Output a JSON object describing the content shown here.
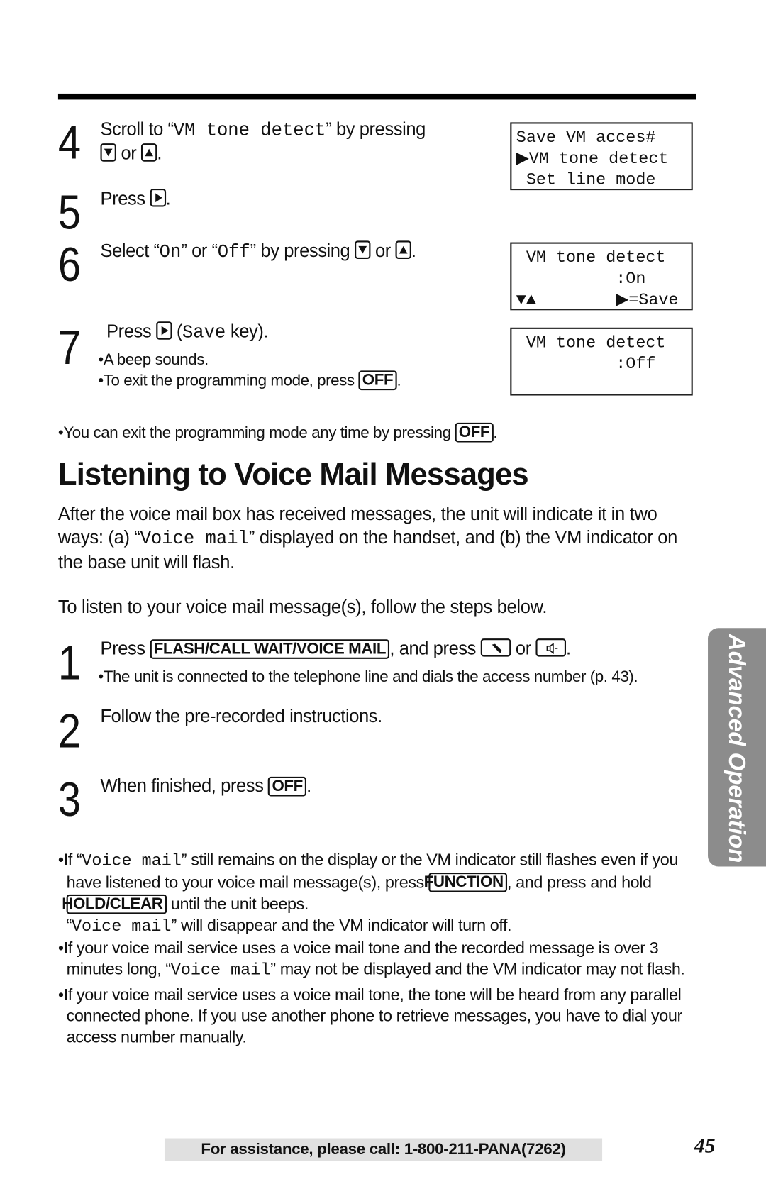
{
  "steps_top": [
    {
      "num": "4",
      "pre": "Scroll to “",
      "mono": "VM tone detect",
      "post": "” by pressing",
      "line2_or": " or ",
      "line2_end": "."
    },
    {
      "num": "5",
      "pre": "Press ",
      "end": "."
    },
    {
      "num": "6",
      "a": "Select “",
      "on": "On",
      "b": "” or “",
      "off": "Off",
      "c": "” by pressing ",
      "or": " or ",
      "end": "."
    },
    {
      "num": "7",
      "pre": "Press ",
      "paren_open": " (",
      "save": "Save",
      "post": " key).",
      "bullet1": "•A beep sounds.",
      "bullet2": "•To exit the programming mode, press ",
      "off_key": "OFF",
      "end": "."
    }
  ],
  "lcd": [
    [
      "Save VM acces#",
      "▶VM tone detect",
      " Set line mode"
    ],
    [
      " VM tone detect",
      "          :On",
      "▼▲        ▶=Save"
    ],
    [
      " VM tone detect",
      "          :Off",
      ""
    ]
  ],
  "exit_note": {
    "text": "•You can exit the programming mode any time by pressing ",
    "key": "OFF",
    "end": "."
  },
  "heading": "Listening to Voice Mail Messages",
  "intro": {
    "a": "After the voice mail box has received messages, the unit will indicate it in two ways: (a) “",
    "mono": "Voice mail",
    "b": "” displayed on the handset, and (b) the VM indicator on the base unit will flash."
  },
  "listen": "To listen to your voice mail message(s), follow the steps below.",
  "steps": [
    {
      "num": "1",
      "pre": "Press ",
      "key": "FLASH/CALL WAIT/VOICE MAIL",
      "mid": ", and press ",
      "or": " or ",
      "end": ".",
      "bullet": "•The unit is connected to the telephone line and dials the access number (p. 43)."
    },
    {
      "num": "2",
      "text": "Follow the pre-recorded instructions."
    },
    {
      "num": "3",
      "text": "When finished, press ",
      "key": "OFF",
      "end": "."
    }
  ],
  "notes": {
    "n1a": "•If “",
    "vm": "Voice mail",
    "n1b": "” still remains on the display or the VM indicator still flashes even if you have listened to your voice mail message(s), press ",
    "function_key": "FUNCTION",
    "n1c": ", and press and hold ",
    "hold_key": "HOLD/CLEAR",
    "n1d": " until the unit beeps.",
    "n1e_a": "“",
    "n1e_b": "” will disappear and the VM indicator will turn off.",
    "n2a": "•If your voice mail service uses a voice mail tone and the recorded message is over 3 minutes long, “",
    "n2b": "” may not be displayed and the VM indicator may not flash.",
    "n3": "•If your voice mail service uses a voice mail tone, the tone will be heard from any parallel connected phone. If you use another phone to retrieve messages, you have to dial your access number manually."
  },
  "side_tab": "Advanced Operation",
  "footer": "For assistance, please call: 1-800-211-PANA(7262)",
  "page_number": "45",
  "icons": {
    "down": "down-arrow-key-icon",
    "up": "up-arrow-key-icon",
    "right": "right-arrow-key-icon",
    "talk": "talk-phone-key-icon",
    "speaker": "speakerphone-key-icon"
  },
  "colors": {
    "side_tab": "#8c8c8c",
    "footer_bg": "#e0e0e0"
  }
}
